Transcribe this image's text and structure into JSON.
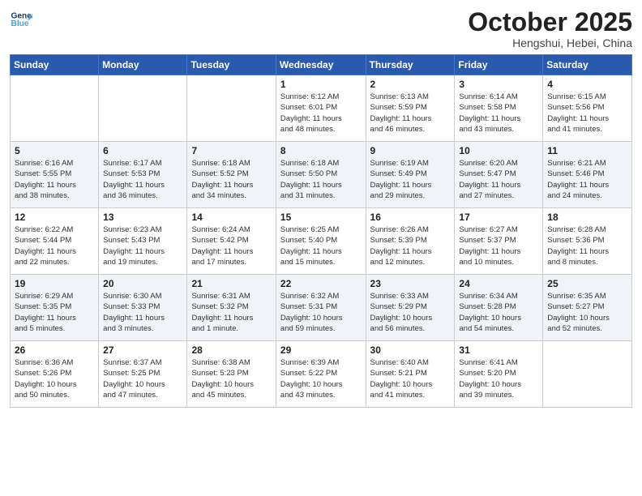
{
  "logo": {
    "line1": "General",
    "line2": "Blue"
  },
  "header": {
    "month": "October 2025",
    "location": "Hengshui, Hebei, China"
  },
  "weekdays": [
    "Sunday",
    "Monday",
    "Tuesday",
    "Wednesday",
    "Thursday",
    "Friday",
    "Saturday"
  ],
  "weeks": [
    [
      {
        "day": "",
        "info": ""
      },
      {
        "day": "",
        "info": ""
      },
      {
        "day": "",
        "info": ""
      },
      {
        "day": "1",
        "info": "Sunrise: 6:12 AM\nSunset: 6:01 PM\nDaylight: 11 hours\nand 48 minutes."
      },
      {
        "day": "2",
        "info": "Sunrise: 6:13 AM\nSunset: 5:59 PM\nDaylight: 11 hours\nand 46 minutes."
      },
      {
        "day": "3",
        "info": "Sunrise: 6:14 AM\nSunset: 5:58 PM\nDaylight: 11 hours\nand 43 minutes."
      },
      {
        "day": "4",
        "info": "Sunrise: 6:15 AM\nSunset: 5:56 PM\nDaylight: 11 hours\nand 41 minutes."
      }
    ],
    [
      {
        "day": "5",
        "info": "Sunrise: 6:16 AM\nSunset: 5:55 PM\nDaylight: 11 hours\nand 38 minutes."
      },
      {
        "day": "6",
        "info": "Sunrise: 6:17 AM\nSunset: 5:53 PM\nDaylight: 11 hours\nand 36 minutes."
      },
      {
        "day": "7",
        "info": "Sunrise: 6:18 AM\nSunset: 5:52 PM\nDaylight: 11 hours\nand 34 minutes."
      },
      {
        "day": "8",
        "info": "Sunrise: 6:18 AM\nSunset: 5:50 PM\nDaylight: 11 hours\nand 31 minutes."
      },
      {
        "day": "9",
        "info": "Sunrise: 6:19 AM\nSunset: 5:49 PM\nDaylight: 11 hours\nand 29 minutes."
      },
      {
        "day": "10",
        "info": "Sunrise: 6:20 AM\nSunset: 5:47 PM\nDaylight: 11 hours\nand 27 minutes."
      },
      {
        "day": "11",
        "info": "Sunrise: 6:21 AM\nSunset: 5:46 PM\nDaylight: 11 hours\nand 24 minutes."
      }
    ],
    [
      {
        "day": "12",
        "info": "Sunrise: 6:22 AM\nSunset: 5:44 PM\nDaylight: 11 hours\nand 22 minutes."
      },
      {
        "day": "13",
        "info": "Sunrise: 6:23 AM\nSunset: 5:43 PM\nDaylight: 11 hours\nand 19 minutes."
      },
      {
        "day": "14",
        "info": "Sunrise: 6:24 AM\nSunset: 5:42 PM\nDaylight: 11 hours\nand 17 minutes."
      },
      {
        "day": "15",
        "info": "Sunrise: 6:25 AM\nSunset: 5:40 PM\nDaylight: 11 hours\nand 15 minutes."
      },
      {
        "day": "16",
        "info": "Sunrise: 6:26 AM\nSunset: 5:39 PM\nDaylight: 11 hours\nand 12 minutes."
      },
      {
        "day": "17",
        "info": "Sunrise: 6:27 AM\nSunset: 5:37 PM\nDaylight: 11 hours\nand 10 minutes."
      },
      {
        "day": "18",
        "info": "Sunrise: 6:28 AM\nSunset: 5:36 PM\nDaylight: 11 hours\nand 8 minutes."
      }
    ],
    [
      {
        "day": "19",
        "info": "Sunrise: 6:29 AM\nSunset: 5:35 PM\nDaylight: 11 hours\nand 5 minutes."
      },
      {
        "day": "20",
        "info": "Sunrise: 6:30 AM\nSunset: 5:33 PM\nDaylight: 11 hours\nand 3 minutes."
      },
      {
        "day": "21",
        "info": "Sunrise: 6:31 AM\nSunset: 5:32 PM\nDaylight: 11 hours\nand 1 minute."
      },
      {
        "day": "22",
        "info": "Sunrise: 6:32 AM\nSunset: 5:31 PM\nDaylight: 10 hours\nand 59 minutes."
      },
      {
        "day": "23",
        "info": "Sunrise: 6:33 AM\nSunset: 5:29 PM\nDaylight: 10 hours\nand 56 minutes."
      },
      {
        "day": "24",
        "info": "Sunrise: 6:34 AM\nSunset: 5:28 PM\nDaylight: 10 hours\nand 54 minutes."
      },
      {
        "day": "25",
        "info": "Sunrise: 6:35 AM\nSunset: 5:27 PM\nDaylight: 10 hours\nand 52 minutes."
      }
    ],
    [
      {
        "day": "26",
        "info": "Sunrise: 6:36 AM\nSunset: 5:26 PM\nDaylight: 10 hours\nand 50 minutes."
      },
      {
        "day": "27",
        "info": "Sunrise: 6:37 AM\nSunset: 5:25 PM\nDaylight: 10 hours\nand 47 minutes."
      },
      {
        "day": "28",
        "info": "Sunrise: 6:38 AM\nSunset: 5:23 PM\nDaylight: 10 hours\nand 45 minutes."
      },
      {
        "day": "29",
        "info": "Sunrise: 6:39 AM\nSunset: 5:22 PM\nDaylight: 10 hours\nand 43 minutes."
      },
      {
        "day": "30",
        "info": "Sunrise: 6:40 AM\nSunset: 5:21 PM\nDaylight: 10 hours\nand 41 minutes."
      },
      {
        "day": "31",
        "info": "Sunrise: 6:41 AM\nSunset: 5:20 PM\nDaylight: 10 hours\nand 39 minutes."
      },
      {
        "day": "",
        "info": ""
      }
    ]
  ]
}
